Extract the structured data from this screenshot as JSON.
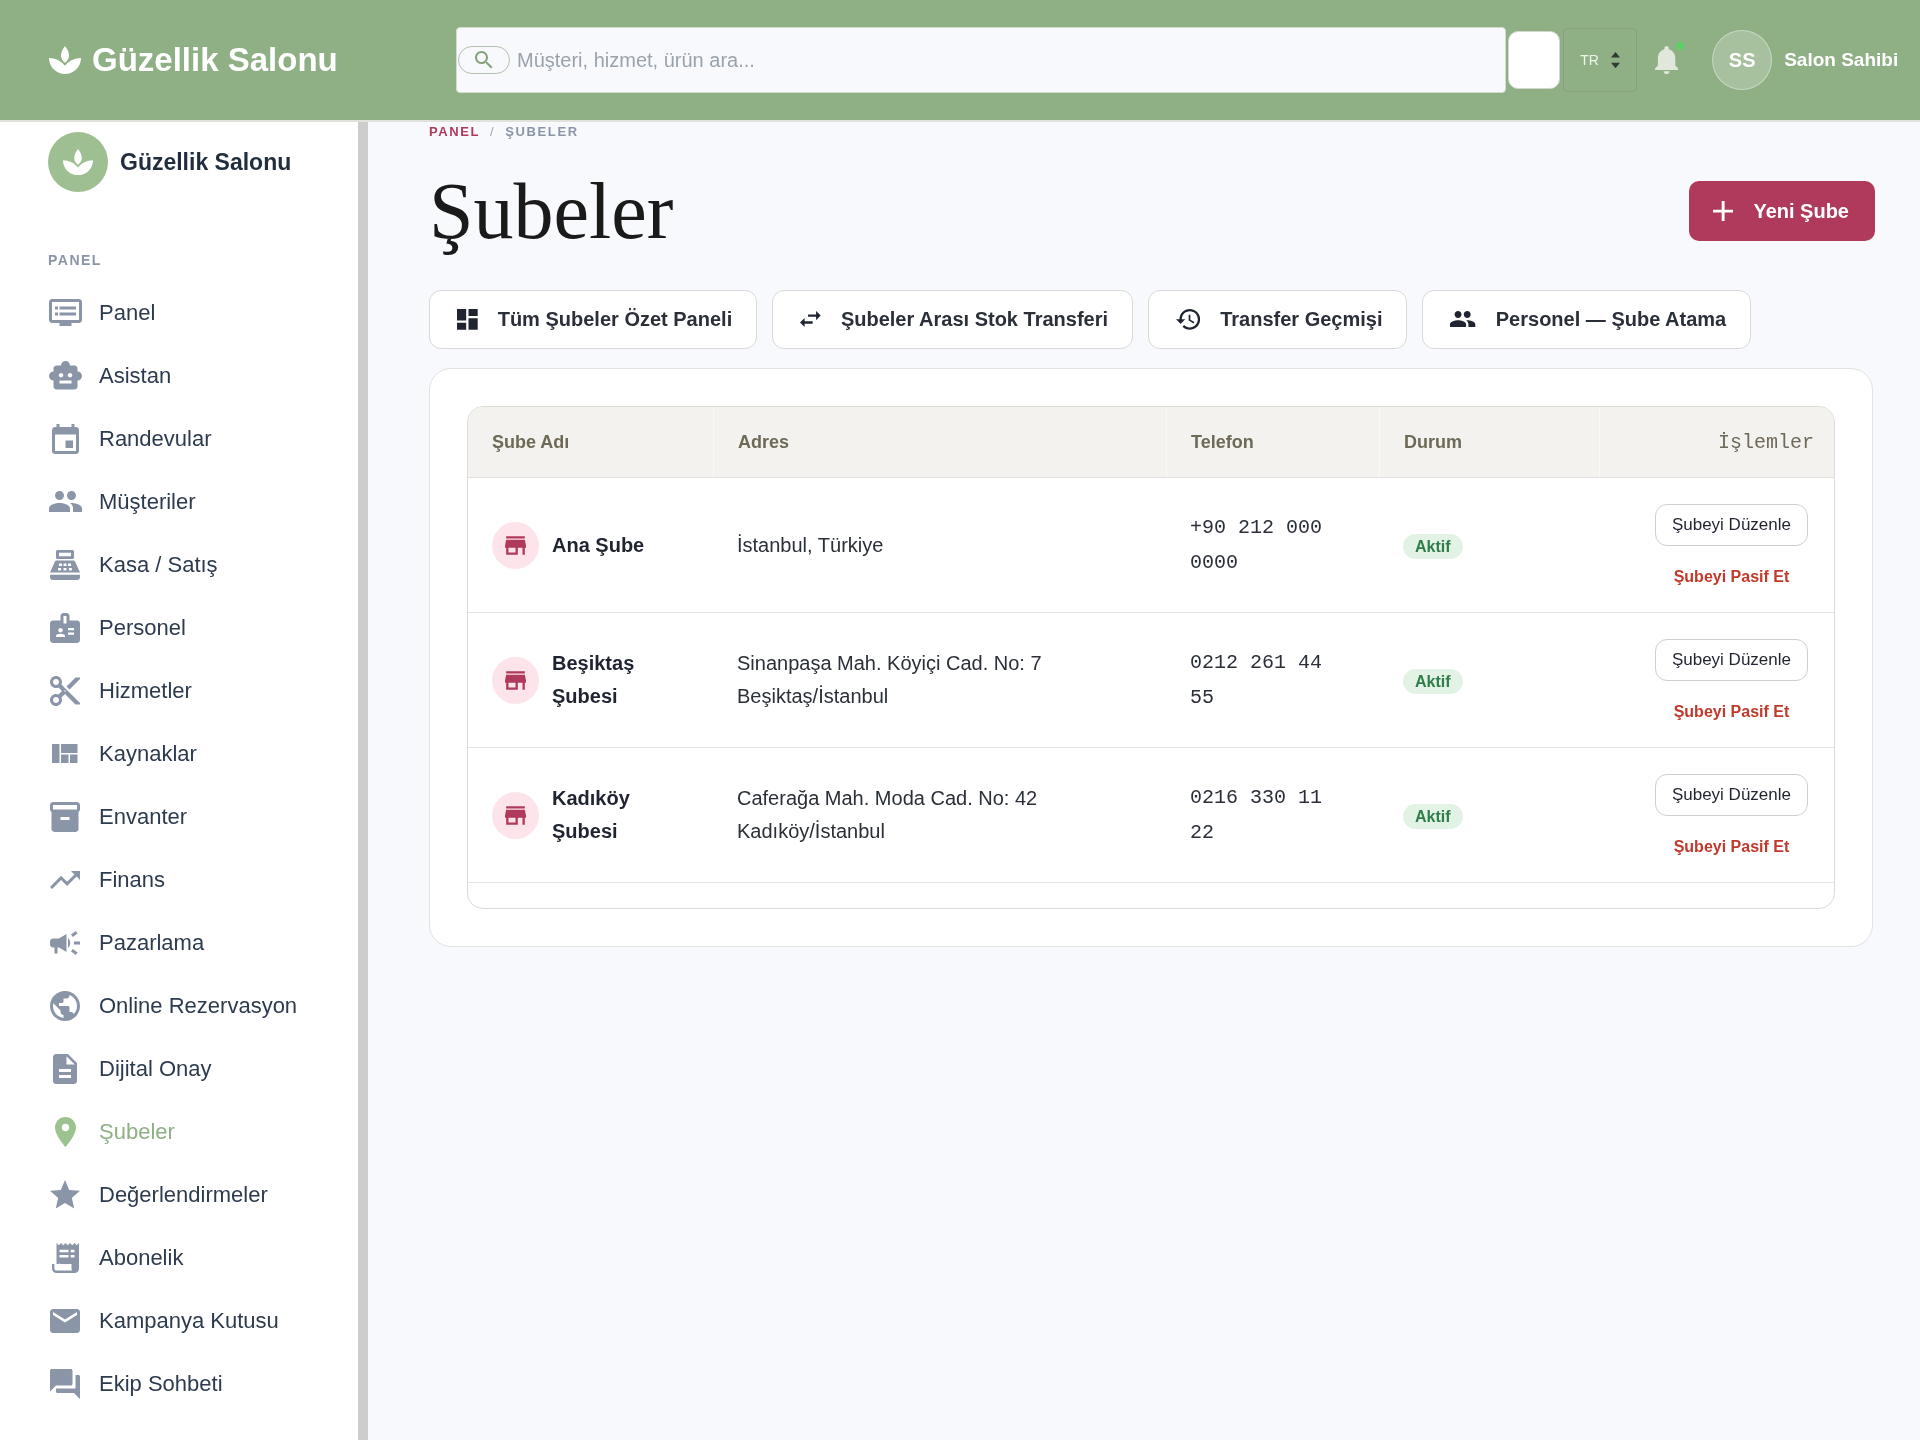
{
  "header": {
    "brand": "Güzellik Salonu",
    "search": {
      "placeholder": "Müşteri, hizmet, ürün ara..."
    },
    "language": "TR",
    "notifications": {
      "unread": true
    },
    "user": {
      "initials": "SS",
      "name": "Salon Sahibi"
    }
  },
  "sidebar": {
    "brand": "Güzellik Salonu",
    "section": "PANEL",
    "items": [
      {
        "label": "Panel",
        "selected": false
      },
      {
        "label": "Asistan",
        "selected": false
      },
      {
        "label": "Randevular",
        "selected": false
      },
      {
        "label": "Müşteriler",
        "selected": false
      },
      {
        "label": "Kasa / Satış",
        "selected": false
      },
      {
        "label": "Personel",
        "selected": false
      },
      {
        "label": "Hizmetler",
        "selected": false
      },
      {
        "label": "Kaynaklar",
        "selected": false
      },
      {
        "label": "Envanter",
        "selected": false
      },
      {
        "label": "Finans",
        "selected": false
      },
      {
        "label": "Pazarlama",
        "selected": false
      },
      {
        "label": "Online Rezervasyon",
        "selected": false
      },
      {
        "label": "Dijital Onay",
        "selected": false
      },
      {
        "label": "Şubeler",
        "selected": true
      },
      {
        "label": "Değerlendirmeler",
        "selected": false
      },
      {
        "label": "Abonelik",
        "selected": false
      },
      {
        "label": "Kampanya Kutusu",
        "selected": false
      },
      {
        "label": "Ekip Sohbeti",
        "selected": false
      }
    ]
  },
  "breadcrumb": {
    "separator": "/",
    "items": [
      {
        "label": "PANEL",
        "current": false
      },
      {
        "label": "ŞUBELER",
        "current": true
      }
    ]
  },
  "page": {
    "title": "Şubeler",
    "new_button": "Yeni Şube"
  },
  "actions": [
    "Tüm Şubeler Özet Paneli",
    "Şubeler Arası Stok Transferi",
    "Transfer Geçmişi",
    "Personel — Şube Atama"
  ],
  "table": {
    "columns": [
      "Şube Adı",
      "Adres",
      "Telefon",
      "Durum",
      "İşlemler"
    ],
    "rows": [
      {
        "name": "Ana Şube",
        "address": "İstanbul, Türkiye",
        "phone": "+90 212 000 0000",
        "status": "Aktif",
        "edit": "Şubeyi Düzenle",
        "deactivate": "Şubeyi Pasif Et"
      },
      {
        "name": "Beşiktaş Şubesi",
        "address": "Sinanpaşa Mah. Köyiçi Cad. No: 7 Beşiktaş/İstanbul",
        "phone": "0212 261 44 55",
        "status": "Aktif",
        "edit": "Şubeyi Düzenle",
        "deactivate": "Şubeyi Pasif Et"
      },
      {
        "name": "Kadıköy Şubesi",
        "address": "Caferağa Mah. Moda Cad. No: 42 Kadıköy/İstanbul",
        "phone": "0216 330 11 22",
        "status": "Aktif",
        "edit": "Şubeyi Düzenle",
        "deactivate": "Şubeyi Pasif Et"
      }
    ]
  }
}
